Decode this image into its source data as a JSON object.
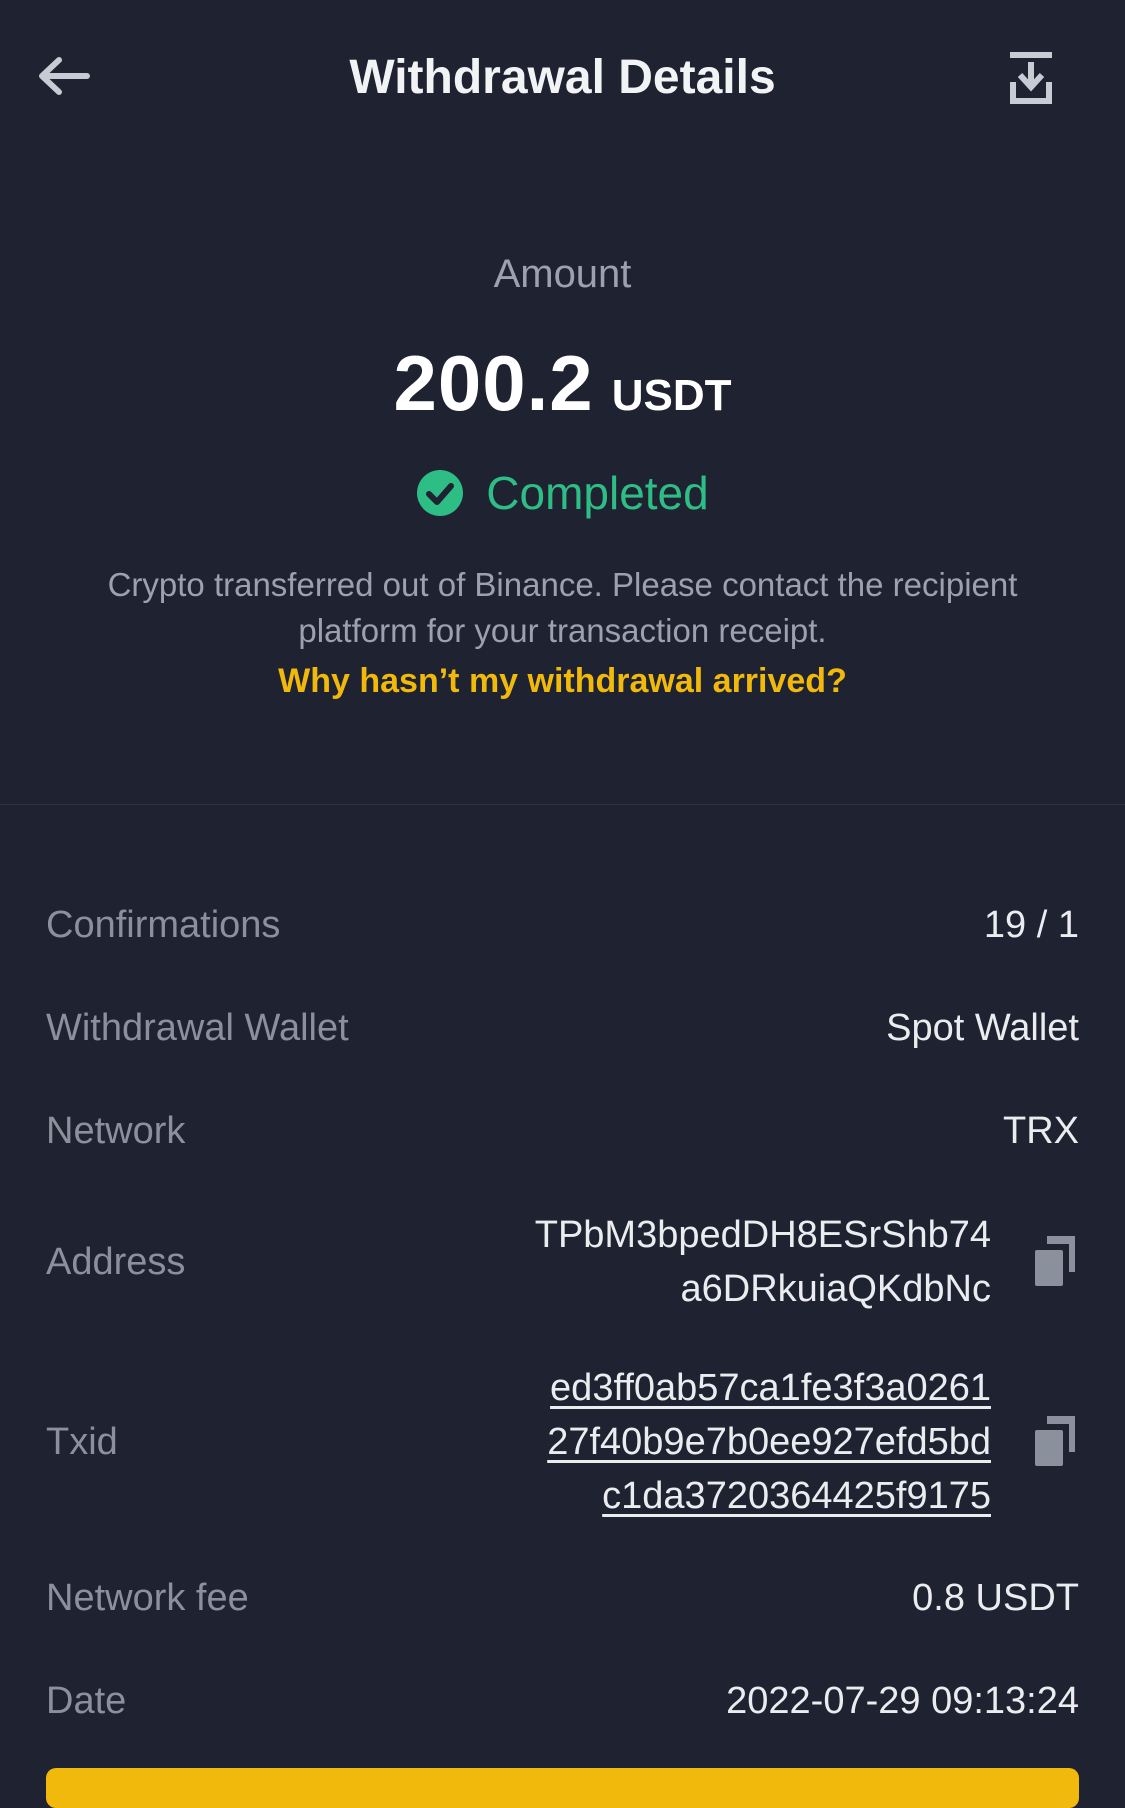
{
  "header": {
    "title": "Withdrawal Details",
    "back_icon": "arrow-left-icon",
    "download_icon": "download-icon"
  },
  "summary": {
    "amount_label": "Amount",
    "amount_value": "200.2",
    "amount_unit": "USDT",
    "status": "Completed",
    "status_color": "#2ebd85",
    "info_text": "Crypto transferred out of Binance. Please contact the recipient platform for your transaction receipt.",
    "help_link": "Why hasn’t my withdrawal arrived?",
    "link_color": "#f0b90b"
  },
  "details": {
    "confirmations": {
      "label": "Confirmations",
      "value": "19 / 1"
    },
    "wallet": {
      "label": "Withdrawal Wallet",
      "value": "Spot Wallet"
    },
    "network": {
      "label": "Network",
      "value": "TRX"
    },
    "address": {
      "label": "Address",
      "lines": [
        "TPbM3bpedDH8ESrShb74",
        "a6DRkuiaQKdbNc"
      ]
    },
    "txid": {
      "label": "Txid",
      "lines": [
        "ed3ff0ab57ca1fe3f3a0261",
        "27f40b9e7b0ee927efd5bd",
        "c1da3720364425f9175"
      ]
    },
    "fee": {
      "label": "Network fee",
      "value": "0.8 USDT"
    },
    "date": {
      "label": "Date",
      "value": "2022-07-29 09:13:24"
    }
  },
  "colors": {
    "background": "#1f2230",
    "accent": "#f0b90b",
    "success": "#2ebd85"
  }
}
